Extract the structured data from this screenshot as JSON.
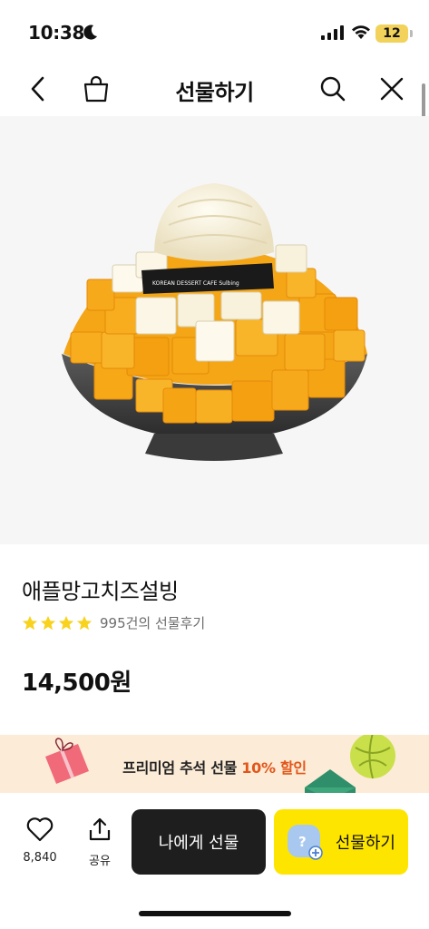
{
  "status_bar": {
    "time": "10:38",
    "battery": "12"
  },
  "nav": {
    "title": "선물하기",
    "icons": [
      "back-icon",
      "shopping-bag-icon",
      "search-icon",
      "close-icon"
    ]
  },
  "product": {
    "image_logo_text": "KOREAN DESSERT CAFE Sulbing",
    "name": "애플망고치즈설빙",
    "rating_stars": 4,
    "review_text": "995건의 선물후기",
    "price": "14,500원"
  },
  "promo": {
    "text_prefix": "프리미엄 추석 선물 ",
    "text_highlight": "10% 할인"
  },
  "bottom_bar": {
    "like_count": "8,840",
    "share_label": "공유",
    "self_gift_label": "나에게 선물",
    "gift_label": "선물하기"
  },
  "colors": {
    "accent_yellow": "#fee500",
    "dark_button": "#1e1e1e",
    "promo_bg": "#fcebd6",
    "promo_highlight": "#e2561a",
    "star": "#f8d21c"
  }
}
